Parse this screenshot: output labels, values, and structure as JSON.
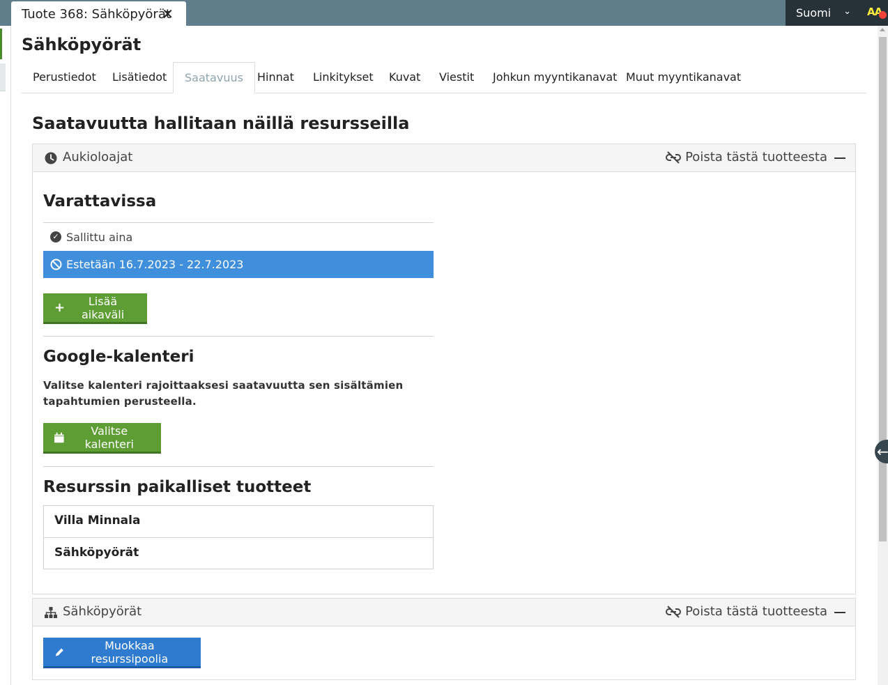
{
  "doc_tab": {
    "title": "Tuote 368: Sähköpyörät",
    "close": "✕"
  },
  "language": {
    "selected": "Suomi"
  },
  "accessibility": {
    "label": "AA"
  },
  "page": {
    "title": "Sähköpyörät"
  },
  "tabs": [
    {
      "label": "Perustiedot"
    },
    {
      "label": "Lisätiedot"
    },
    {
      "label": "Saatavuus"
    },
    {
      "label": "Hinnat"
    },
    {
      "label": "Linkitykset"
    },
    {
      "label": "Kuvat"
    },
    {
      "label": "Viestit"
    },
    {
      "label": "Johkun myyntikanavat"
    },
    {
      "label": "Muut myyntikanavat"
    }
  ],
  "active_tab": "Saatavuus",
  "section_title": "Saatavuutta hallitaan näillä resursseilla",
  "resource1": {
    "name": "Aukioloajat",
    "icon": "clock-icon",
    "remove_label": "Poista tästä tuotteesta",
    "available": {
      "heading": "Varattavissa",
      "allowed": "Sallittu aina",
      "blocked": "Estetään 16.7.2023 - 22.7.2023",
      "add_button": "Lisää aikaväli"
    },
    "google": {
      "heading": "Google-kalenteri",
      "description": "Valitse kalenteri rajoittaaksesi saatavuutta sen sisältämien tapahtumien perusteella.",
      "button": "Valitse kalenteri"
    },
    "local_products": {
      "heading": "Resurssin paikalliset tuotteet",
      "items": [
        "Villa Minnala",
        "Sähköpyörät"
      ]
    }
  },
  "resource2": {
    "name": "Sähköpyörät",
    "icon": "sitemap-icon",
    "remove_label": "Poista tästä tuotteesta",
    "edit_button": "Muokkaa resurssipoolia"
  },
  "colors": {
    "topbar": "#607d8b",
    "dark": "#263238",
    "green_button": "#5d9d33",
    "blue_button": "#2e7bcf",
    "selected_row": "#3f8fdc"
  }
}
